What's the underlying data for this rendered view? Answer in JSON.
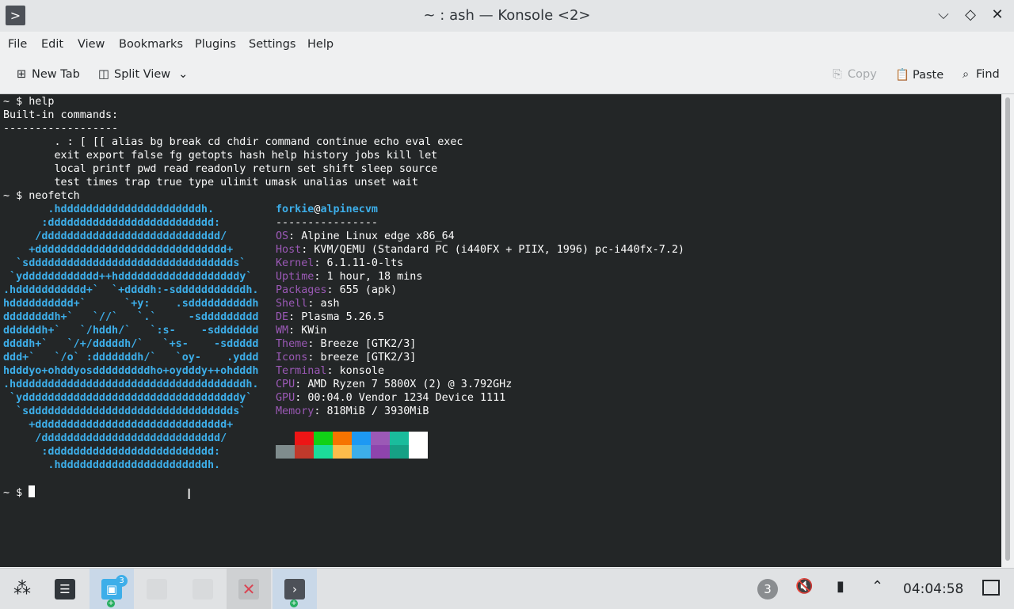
{
  "window": {
    "title": "~ : ash — Konsole <2>",
    "app_icon_glyph": ">",
    "minimize_glyph": "⌵",
    "maximize_glyph": "◇",
    "close_glyph": "✕"
  },
  "menu": [
    "File",
    "Edit",
    "View",
    "Bookmarks",
    "Plugins",
    "Settings",
    "Help"
  ],
  "toolbar": {
    "new_tab": "New Tab",
    "split_view": "Split View",
    "copy": "Copy",
    "paste": "Paste",
    "find": "Find"
  },
  "terminal": {
    "lines": [
      "~ $ help",
      "Built-in commands:",
      "------------------",
      "        . : [ [[ alias bg break cd chdir command continue echo eval exec",
      "        exit export false fg getopts hash help history jobs kill let",
      "        local printf pwd read readonly return set shift sleep source",
      "        test times trap true type ulimit umask unalias unset wait",
      "~ $ neofetch"
    ],
    "logo": [
      "       .hddddddddddddddddddddddh.",
      "      :dddddddddddddddddddddddddd:",
      "     /dddddddddddddddddddddddddddd/",
      "    +dddddddddddddddddddddddddddddd+",
      "  `sdddddddddddddddddddddddddddddddds`",
      " `ydddddddddddd++hdddddddddddddddddddy`",
      ".hddddddddddd+`  `+ddddh:-sdddddddddddh.",
      "hdddddddddd+`      `+y:    .sddddddddddh",
      "ddddddddh+`   `//`   `.`     -sddddddddd",
      "ddddddh+`   `/hddh/`   `:s-    -sddddddd",
      "ddddh+`   `/+/dddddh/`   `+s-    -sddddd",
      "ddd+`   `/o` :dddddddh/`   `oy-    .yddd",
      "hdddyo+ohddyosdddddddddho+oydddy++ohdddh",
      ".hddddddddddddddddddddddddddddddddddddh.",
      " `yddddddddddddddddddddddddddddddddddy`",
      "  `sdddddddddddddddddddddddddddddddds`",
      "    +dddddddddddddddddddddddddddddd+",
      "     /dddddddddddddddddddddddddddd/",
      "      :dddddddddddddddddddddddddd:",
      "       .hdddddddddddddddddddddddh."
    ],
    "user": "forkie",
    "at": "@",
    "hostname": "alpinecvm",
    "separator": "----------------",
    "info": [
      {
        "label": "OS",
        "value": "Alpine Linux edge x86_64"
      },
      {
        "label": "Host",
        "value": "KVM/QEMU (Standard PC (i440FX + PIIX, 1996) pc-i440fx-7.2)"
      },
      {
        "label": "Kernel",
        "value": "6.1.11-0-lts"
      },
      {
        "label": "Uptime",
        "value": "1 hour, 18 mins"
      },
      {
        "label": "Packages",
        "value": "655 (apk)"
      },
      {
        "label": "Shell",
        "value": "ash"
      },
      {
        "label": "DE",
        "value": "Plasma 5.26.5"
      },
      {
        "label": "WM",
        "value": "KWin"
      },
      {
        "label": "Theme",
        "value": "Breeze [GTK2/3]"
      },
      {
        "label": "Icons",
        "value": "breeze [GTK2/3]"
      },
      {
        "label": "Terminal",
        "value": "konsole"
      },
      {
        "label": "CPU",
        "value": "AMD Ryzen 7 5800X (2) @ 3.792GHz"
      },
      {
        "label": "GPU",
        "value": "00:04.0 Vendor 1234 Device 1111"
      },
      {
        "label": "Memory",
        "value": "818MiB / 3930MiB"
      }
    ],
    "palette_top": [
      "#232627",
      "#ed1515",
      "#11d116",
      "#f67400",
      "#1d99f3",
      "#9b59b6",
      "#1abc9c",
      "#ffffff"
    ],
    "palette_bottom": [
      "#7f8c8d",
      "#c0392b",
      "#1cdc9a",
      "#fdbc4b",
      "#3daee9",
      "#8e44ad",
      "#16a085",
      "#ffffff"
    ],
    "prompt": "~ $ "
  },
  "taskbar": {
    "badge_count": "3",
    "tray_badge": "3",
    "clock": "04:04:58"
  }
}
